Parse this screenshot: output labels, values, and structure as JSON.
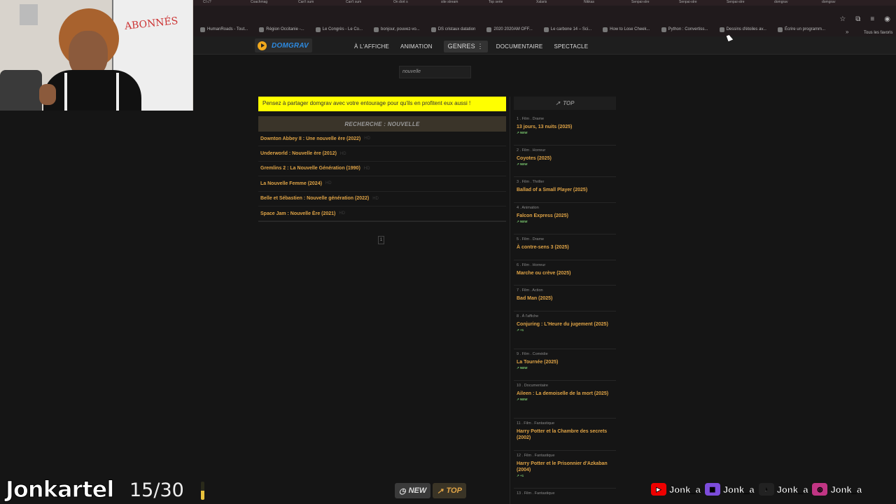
{
  "browser": {
    "tabs": [
      "CI c?",
      "Coachmag",
      "Can't sum",
      "Can't sum",
      "On dort s",
      "site stream",
      "Top serie",
      "Xalaris",
      "Nikkas",
      "Senpai-stre",
      "Senpai-stre",
      "Senpai-stre",
      "domgrav",
      "domgrav"
    ],
    "bookmarks": [
      "HumanRoads - Tout...",
      "Région Occitanie -...",
      "Le Congrès - Le Co...",
      "bonjour, pouvez-vo...",
      "DS cristaux datation",
      "2020 2020AM OFF...",
      "Le carbone 14 – Sci...",
      "How to Lose Cheek...",
      "Python : Convertiss...",
      "Dessins d'étoiles av...",
      "Écrire un programm..."
    ],
    "bookmarks_more": "»",
    "all_bookmarks": "Tous les favoris"
  },
  "site": {
    "logo": "DOMGRAV",
    "nav": [
      "À L'AFFICHE",
      "ANIMATION",
      "GENRES",
      "DOCUMENTAIRE",
      "SPECTACLE"
    ],
    "search_value": "nouvelle",
    "banner": "Pensez à partager domgrav avec votre entourage pour qu'ils en profitent eux aussi !",
    "results_heading": "RECHERCHE : NOUVELLE",
    "results": [
      "Downton Abbey II : Une nouvelle ère (2022)",
      "Underworld : Nouvelle ère (2012)",
      "Gremlins 2 : La Nouvelle Génération (1990)",
      "La Nouvelle Femme (2024)",
      "Belle et Sébastien : Nouvelle génération (2022)",
      "Space Jam : Nouvelle Ère (2021)"
    ],
    "result_tail": "HD",
    "page": "1"
  },
  "top": {
    "heading": "TOP",
    "items": [
      {
        "meta": "1 . Film . Drame",
        "title": "13 jours, 13 nuits (2025)",
        "badge": "NEW"
      },
      {
        "meta": "2 . Film . Horreur",
        "title": "Coyotes (2025)",
        "badge": "NEW"
      },
      {
        "meta": "3 . Film . Thriller",
        "title": "Ballad of a Small Player (2025)",
        "badge": ""
      },
      {
        "meta": "4 . Animation",
        "title": "Falcon Express (2025)",
        "badge": "NEW"
      },
      {
        "meta": "5 . Film . Drame",
        "title": "À contre-sens 3 (2025)",
        "badge": ""
      },
      {
        "meta": "6 . Film . Horreur",
        "title": "Marche ou crève (2025)",
        "badge": ""
      },
      {
        "meta": "7 . Film . Action",
        "title": "Bad Man (2025)",
        "badge": ""
      },
      {
        "meta": "8 . À l'affiche",
        "title": "Conjuring : L'Heure du jugement (2025)",
        "badge": "+1"
      },
      {
        "meta": "9 . Film . Comédie",
        "title": "La Tournée (2025)",
        "badge": "NEW"
      },
      {
        "meta": "10 . Documentaire",
        "title": "Aileen : La demoiselle de la mort (2025)",
        "badge": "NEW"
      },
      {
        "meta": "11 . Film . Fantastique",
        "title": "Harry Potter et la Chambre des secrets (2002)",
        "badge": ""
      },
      {
        "meta": "12 . Film . Fantastique",
        "title": "Harry Potter et le Prisonnier d'Azkaban (2004)",
        "badge": "+1"
      },
      {
        "meta": "13 . Film . Fantastique",
        "title": "",
        "badge": ""
      }
    ]
  },
  "webcam": {
    "board_text": "ABONNÉS"
  },
  "overlay": {
    "streamer": "Jonkartel",
    "progress_text": "15/30",
    "progress_fraction": 0.5,
    "badge_new": "NEW",
    "badge_top": "TOP",
    "socials": [
      {
        "icon": "youtube-icon",
        "handle": "Jonk_a"
      },
      {
        "icon": "twitch-icon",
        "handle": "Jonk_a"
      },
      {
        "icon": "tiktok-icon",
        "handle": "Jonk_a"
      },
      {
        "icon": "instagram-icon",
        "handle": "Jonk_a"
      }
    ]
  },
  "colors": {
    "accent": "#e0a446",
    "banner": "#ffff00",
    "logo": "#2d8ae0",
    "new_badge": "#7bc96f"
  }
}
